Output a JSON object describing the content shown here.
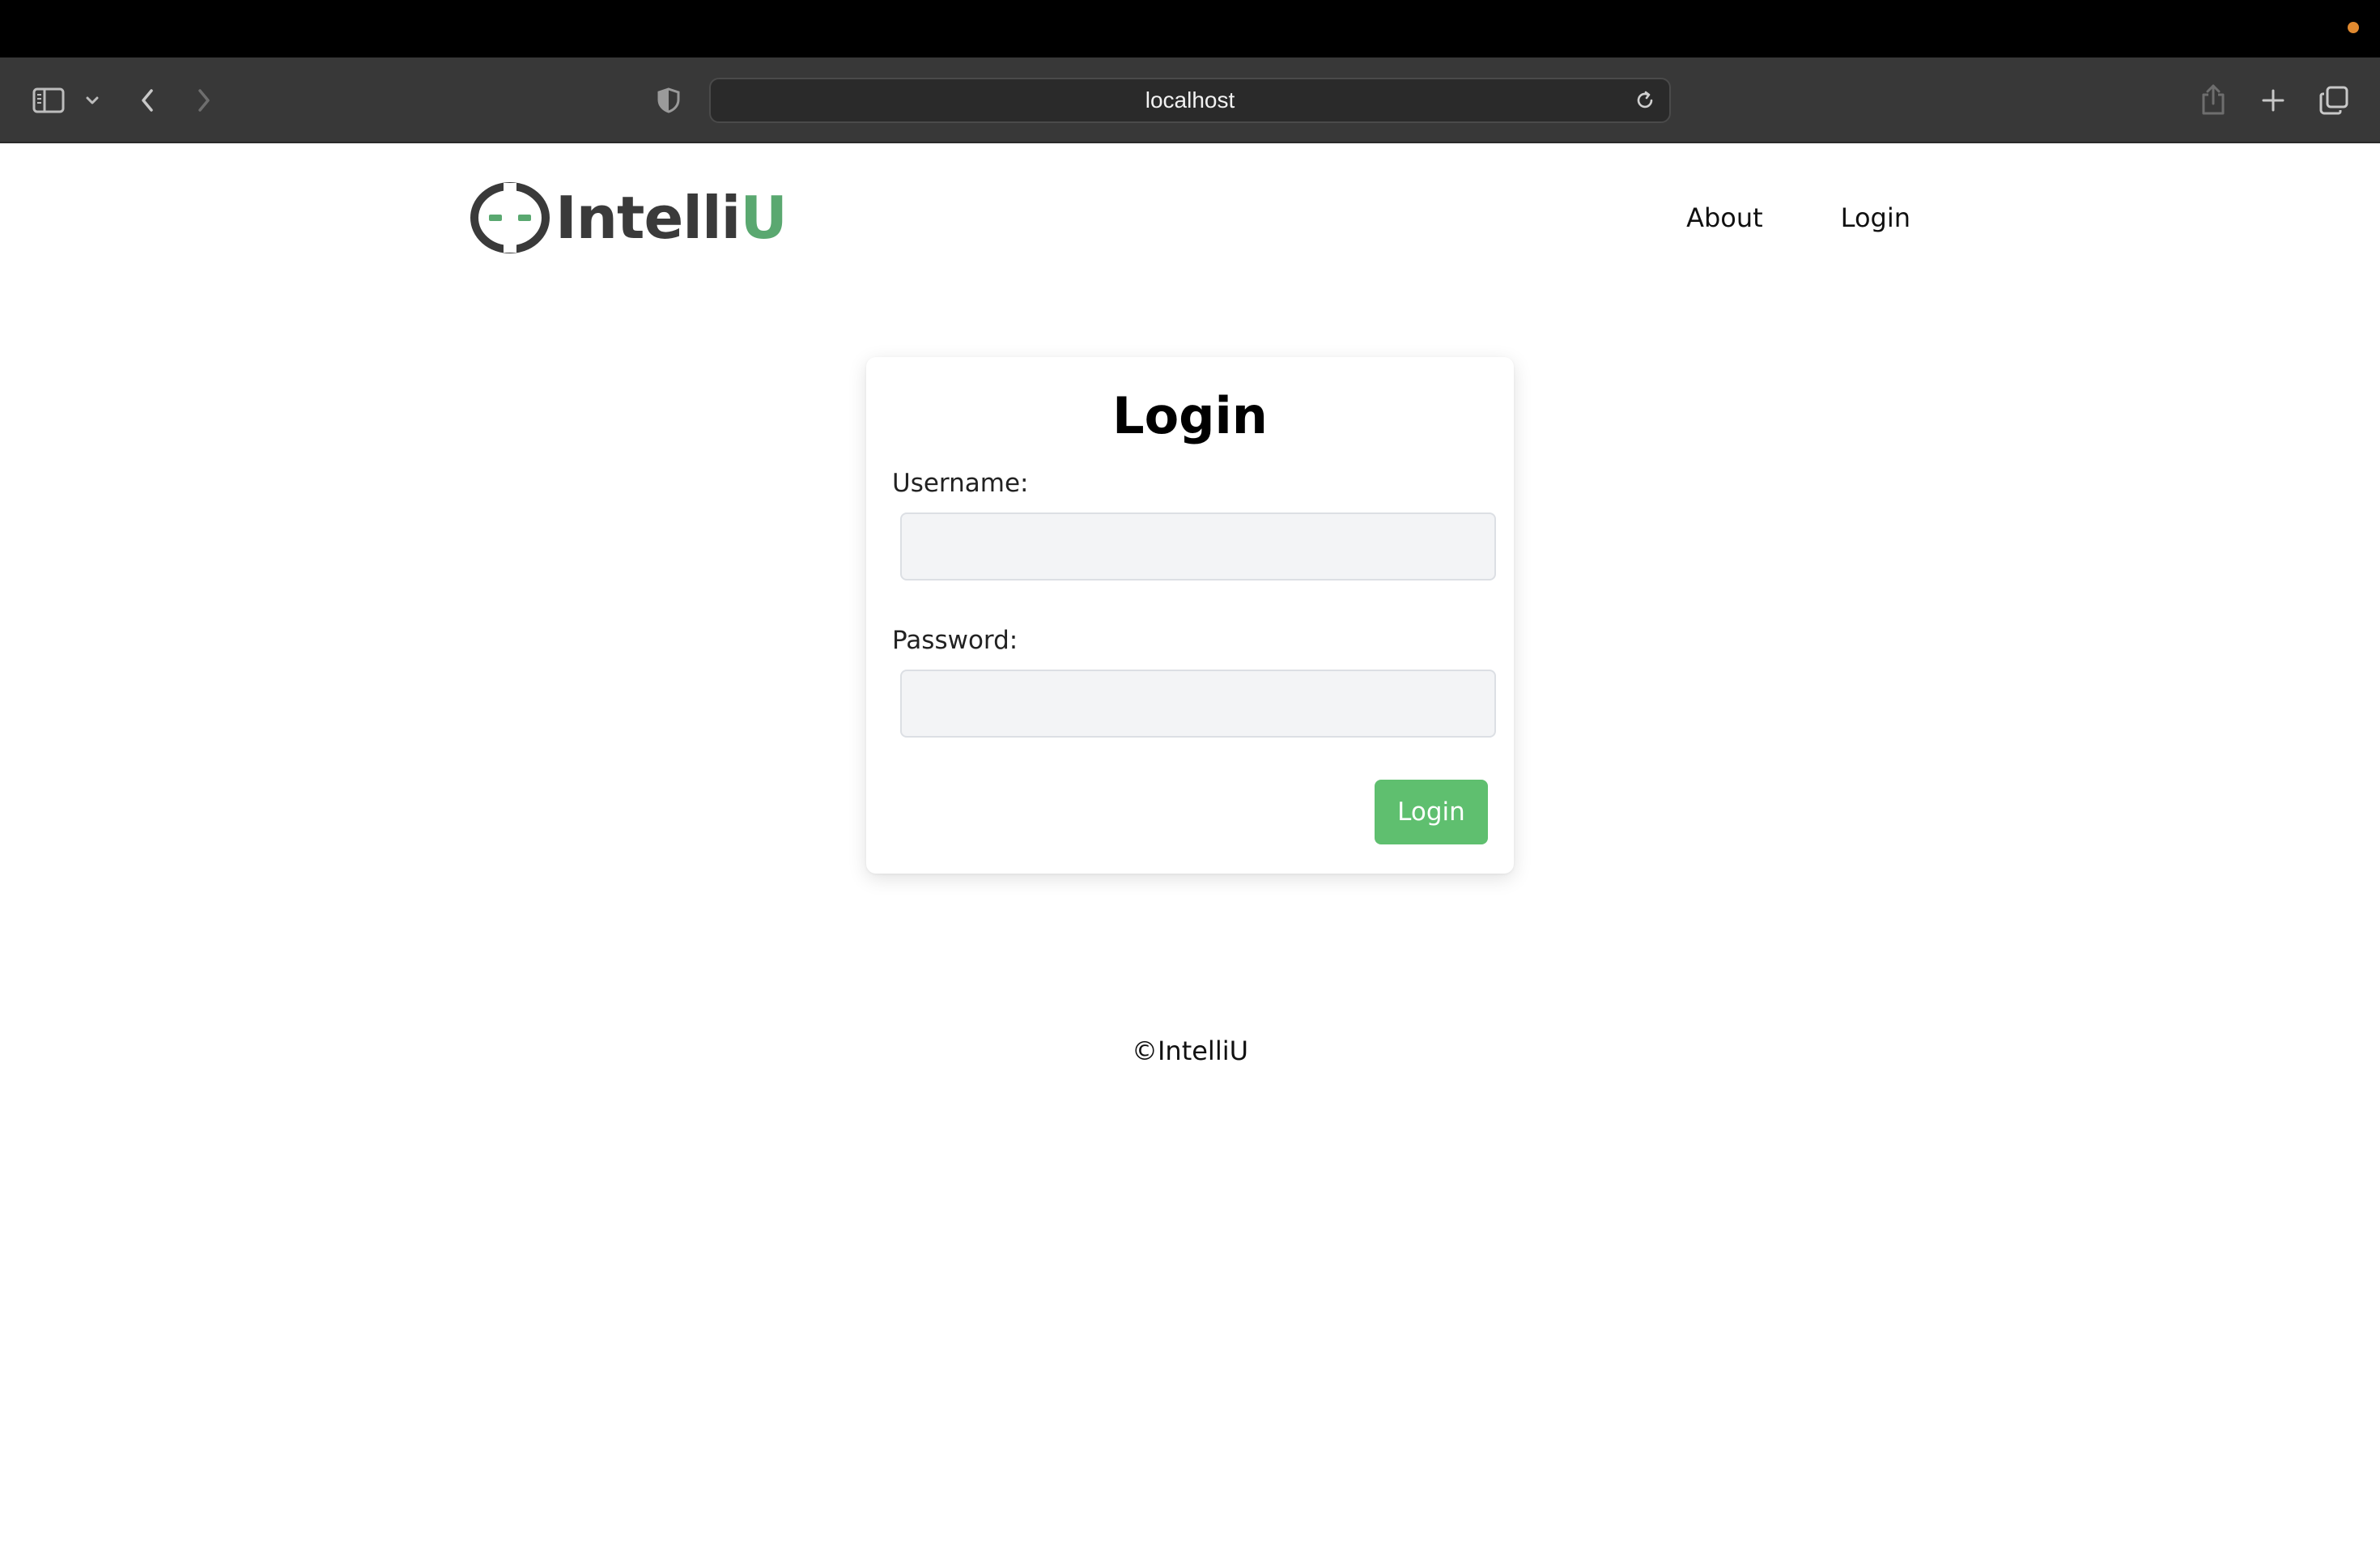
{
  "browser": {
    "address": "localhost",
    "icons": {
      "sidebar": "sidebar-icon",
      "sidebar_menu": "chevron-down-icon",
      "back": "chevron-left-icon",
      "forward": "chevron-right-icon",
      "privacy": "shield-icon",
      "reload": "reload-icon",
      "share": "share-icon",
      "new_tab": "plus-icon",
      "tab_overview": "tabs-icon"
    },
    "status_dot_color": "#e0892f"
  },
  "header": {
    "logo_text": "Intelli",
    "logo_accent": "U",
    "nav": [
      {
        "label": "About"
      },
      {
        "label": "Login"
      }
    ]
  },
  "login_form": {
    "title": "Login",
    "username_label": "Username:",
    "username_value": "",
    "password_label": "Password:",
    "password_value": "",
    "submit_label": "Login"
  },
  "footer": {
    "text": "©IntelliU"
  },
  "colors": {
    "accent_green": "#5fbf6f",
    "logo_green": "#5aa870",
    "logo_dark": "#3a3a3a"
  }
}
